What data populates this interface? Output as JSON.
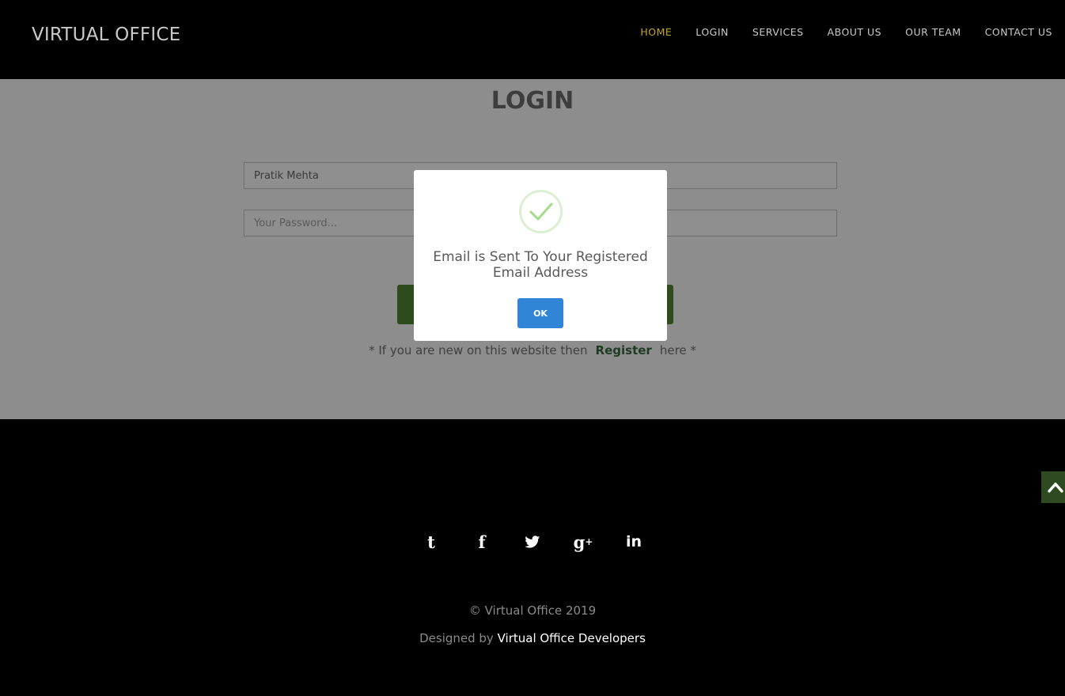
{
  "header": {
    "brand": "VIRTUAL OFFICE",
    "nav": [
      "HOME",
      "LOGIN",
      "SERVICES",
      "ABOUT US",
      "OUR TEAM",
      "CONTACT US"
    ],
    "active_color": "#c2a62a"
  },
  "login": {
    "title": "LOGIN",
    "username_value": "Pratik Mehta",
    "password_placeholder": "Your Password...",
    "register_prefix": "* If you are new on this website then",
    "register_link": "Register",
    "register_suffix": "here *"
  },
  "modal": {
    "icon": "check-icon",
    "message": "Email is Sent To Your Registered Email Address",
    "ok_label": "OK",
    "ok_color": "#3085d6"
  },
  "footer": {
    "social_icons": [
      "tumblr-icon",
      "facebook-icon",
      "twitter-icon",
      "google-plus-icon",
      "linkedin-icon"
    ],
    "copyright": "© Virtual Office 2019",
    "designed_prefix": "Designed by",
    "designed_link": "Virtual Office Developers"
  }
}
